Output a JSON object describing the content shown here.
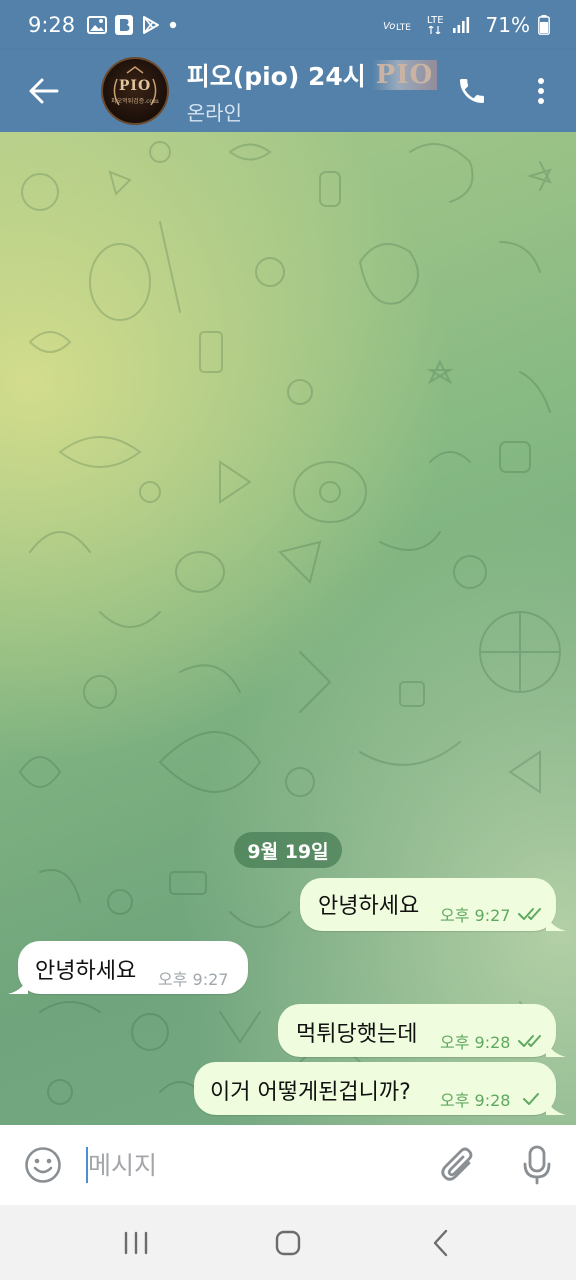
{
  "status_bar": {
    "time": "9:28",
    "network": "LTE",
    "battery": "71%",
    "icons": [
      "gallery-icon",
      "b-app-icon",
      "play-store-icon",
      "dot-icon",
      "volte-icon",
      "signal-icon",
      "battery-icon"
    ]
  },
  "header": {
    "title": "피오(pio) 24시",
    "title_logo": "PIO",
    "status": "온라인",
    "avatar_text": "PIO",
    "avatar_subtext": "피오먹튀검증.com",
    "colors": {
      "bar": "#5381aa"
    }
  },
  "chat": {
    "date_label": "9월 19일",
    "messages": [
      {
        "direction": "out",
        "text": "안녕하세요",
        "time": "오후 9:27",
        "status": "read"
      },
      {
        "direction": "in",
        "text": "안녕하세요",
        "time": "오후 9:27"
      },
      {
        "direction": "out",
        "text": "먹튀당햇는데",
        "time": "오후 9:28",
        "status": "read"
      },
      {
        "direction": "out",
        "text": "이거 어떻게된겁니까?",
        "time": "오후 9:28",
        "status": "sent"
      }
    ],
    "colors": {
      "outgoing_bubble": "#effdde",
      "incoming_bubble": "#ffffff",
      "check": "#5fa860"
    }
  },
  "input": {
    "placeholder": "메시지",
    "value": ""
  },
  "navbar": {
    "icons": [
      "recent-apps-icon",
      "home-icon",
      "back-nav-icon"
    ]
  }
}
